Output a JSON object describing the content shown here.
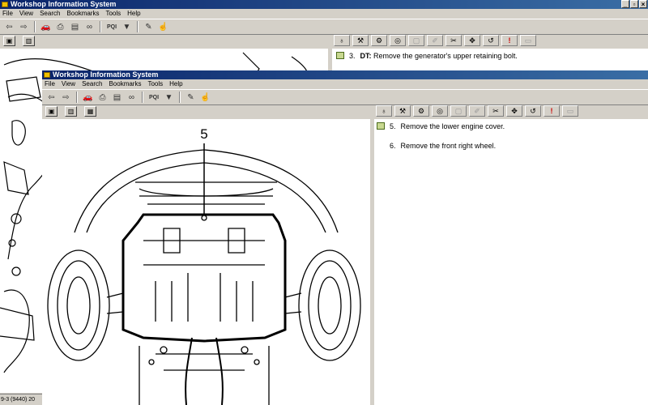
{
  "back_window": {
    "title": "Workshop Information System",
    "menu": [
      "File",
      "View",
      "Search",
      "Bookmarks",
      "Tools",
      "Help"
    ],
    "step": {
      "number": "3.",
      "prefix": "DT:",
      "text": " Remove the generator's upper retaining bolt."
    },
    "step_partial": "DTH Remove the generator's upper retaining bolt.",
    "status": "9-3 (9440) 20"
  },
  "front_window": {
    "title": "Workshop Information System",
    "menu": [
      "File",
      "View",
      "Search",
      "Bookmarks",
      "Tools",
      "Help"
    ],
    "diagram_label": "5",
    "steps": [
      {
        "number": "5.",
        "text": "Remove the lower engine cover."
      },
      {
        "number": "6.",
        "text": "Remove the front right wheel."
      }
    ]
  },
  "toolbar": {
    "pqi_label": "PQI"
  },
  "window_controls": {
    "minimize": "_",
    "restore": "▫",
    "close": "×"
  },
  "icons": [
    "back-arrow-icon",
    "forward-arrow-icon",
    "car-icon",
    "print-icon",
    "bookmark-icon",
    "binoculars-icon",
    "filter-icon",
    "highlight-icon",
    "hand-icon"
  ]
}
